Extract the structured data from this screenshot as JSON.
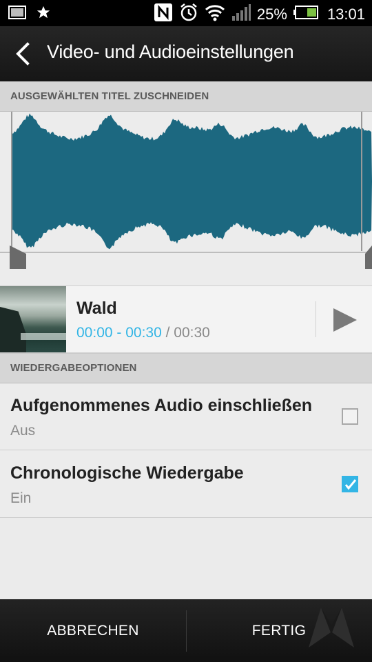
{
  "status_bar": {
    "battery": "25%",
    "time": "13:01"
  },
  "header": {
    "title": "Video- und Audioeinstellungen"
  },
  "trim_section": {
    "header": "AUSGEWÄHLTEN TITEL ZUSCHNEIDEN",
    "waveform_color": "#1c6880"
  },
  "track": {
    "name": "Wald",
    "range": "00:00 - 00:30",
    "separator": " / ",
    "duration": "00:30"
  },
  "playback_section": {
    "header": "WIEDERGABEOPTIONEN",
    "options": [
      {
        "title": "Aufgenommenes Audio einschließen",
        "value": "Aus",
        "checked": false
      },
      {
        "title": "Chronologische Wiedergabe",
        "value": "Ein",
        "checked": true
      }
    ]
  },
  "bottom_bar": {
    "cancel_label": "ABBRECHEN",
    "done_label": "FERTIG"
  },
  "colors": {
    "accent": "#33b5e5",
    "waveform": "#1c6880"
  }
}
